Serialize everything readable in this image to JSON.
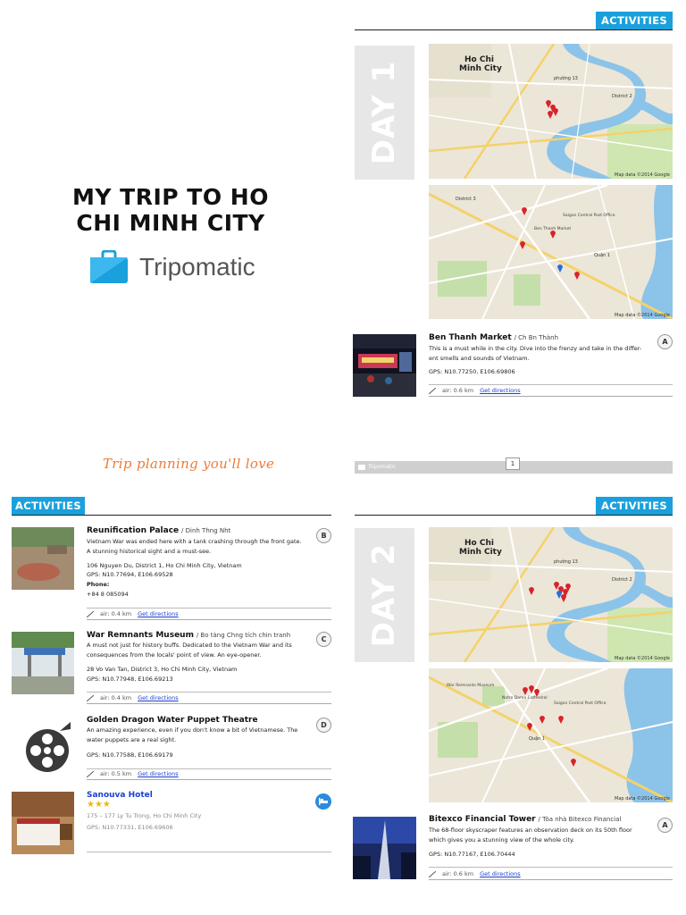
{
  "cover": {
    "title": "MY TRIP TO HO CHI MINH CITY",
    "brand": "Tripomatic",
    "tagline": "Trip planning you'll love"
  },
  "section_label": "ACTIVITIES",
  "days": [
    {
      "label": "DAY 1",
      "overview_map": {
        "labels": [
          "Ho Chi Minh City",
          "District 2",
          "phường 13"
        ],
        "credit": "Map data ©2014 Google"
      },
      "detail_map": {
        "labels": [
          "District 3",
          "Quận 1",
          "Ben Thanh Market",
          "Saigon Central Post Office"
        ],
        "credit": "Map data ©2014 Google"
      },
      "entries": [
        {
          "title": "Ben Thanh Market",
          "subtitle": "Ch Bn Thành",
          "desc": [
            "This is a must while in the city.  Dive into the frenzy and take in the differ-",
            "ent smells and sounds of Vietnam."
          ],
          "gps": "GPS: N10.77250, E106.69806",
          "pin": "A",
          "distance": "air:  0.6 km",
          "directions": "Get directions"
        }
      ]
    },
    {
      "label": "DAY 2",
      "overview_map": {
        "labels": [
          "Ho Chi Minh City",
          "District 2",
          "phường 13"
        ],
        "credit": "Map data ©2014 Google"
      },
      "detail_map": {
        "labels": [
          "War Remnants Museum",
          "Notre Dame Cathedral",
          "Quận 1",
          "Saigon Central Post Office"
        ],
        "credit": "Map data ©2014 Google"
      },
      "entries": [
        {
          "title": "Bitexco Financial Tower",
          "subtitle": "Tòa nhà Bitexco Financial",
          "desc": [
            "The 68-floor skyscraper features an observation deck on its 50th floor",
            "which gives you a stunning view of the whole city."
          ],
          "gps": "GPS: N10.77167, E106.70444",
          "pin": "A",
          "distance": "air:  0.6 km",
          "directions": "Get directions"
        }
      ]
    }
  ],
  "left_entries": [
    {
      "title": "Reunification Palace",
      "subtitle": "Dinh Thng Nht",
      "desc": [
        "Vietnam War was ended here with a tank crashing through the front gate.",
        "A stunning historical sight and a must-see."
      ],
      "address": "106 Nguyen Du, District 1, Ho Chi Minh City, Vietnam",
      "gps": "GPS: N10.77694, E106.69528",
      "phone_label": "Phone:",
      "phone": "+84 8 085094",
      "pin": "B",
      "distance": "air:  0.4 km",
      "directions": "Get directions"
    },
    {
      "title": "War Remnants Museum",
      "subtitle": "Bo tàng Chng tích chin tranh",
      "desc": [
        "A must not just for history buffs.  Dedicated to the Vietnam War and its",
        "consequences from the locals' point of view.  An eye-opener."
      ],
      "address": "28 Vo Van Tan, District 3, Ho Chi Minh City, Vietnam",
      "gps": "GPS: N10.77948, E106.69213",
      "pin": "C",
      "distance": "air:  0.4 km",
      "directions": "Get directions"
    },
    {
      "title": "Golden Dragon Water Puppet Theatre",
      "desc": [
        "An amazing experience, even if you don't know a bit of Vietnamese.  The",
        "water puppets are a real sight."
      ],
      "gps": "GPS: N10.77588, E106.69179",
      "pin": "D",
      "distance": "air:  0.5 km",
      "directions": "Get directions"
    }
  ],
  "hotel": {
    "name": "Sanouva Hotel",
    "stars": "★★★",
    "address": "175 – 177 Ly Tu Trong, Ho Chi Minh City",
    "gps": "GPS: N10.77331, E106.69606"
  },
  "footer": {
    "brand": "Tripomatic",
    "page": "1"
  },
  "colors": {
    "accent": "#1aa0dc",
    "tagline": "#ee7b35",
    "link": "#1b3fd1",
    "water": "#8cc3e9",
    "park": "#c4dfa9"
  }
}
